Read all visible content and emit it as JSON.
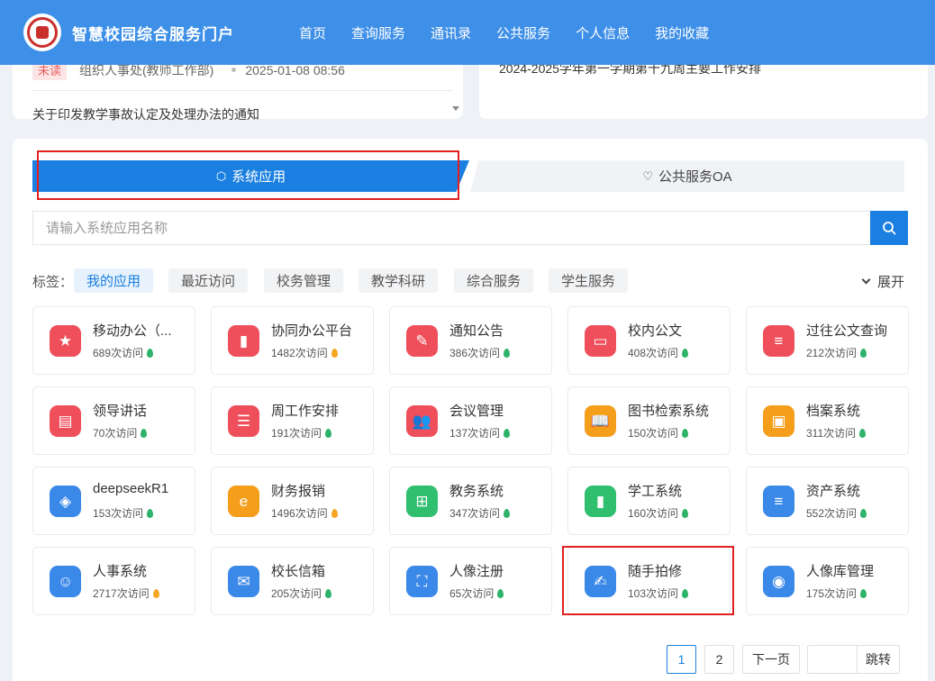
{
  "header": {
    "title": "智慧校园综合服务门户",
    "nav": [
      "首页",
      "查询服务",
      "通讯录",
      "公共服务",
      "个人信息",
      "我的收藏"
    ]
  },
  "notices": {
    "badge": "未读",
    "source": "组织人事处(教师工作部)",
    "date": "2025-01-08 08:56",
    "item2": "关于印发教学事故认定及处理办法的通知",
    "right_item": "2024-2025学年第一学期第十九周主要工作安排"
  },
  "tabs": {
    "system": "系统应用",
    "oa": "公共服务OA"
  },
  "search": {
    "placeholder": "请输入系统应用名称"
  },
  "tags": {
    "label": "标签：",
    "items": [
      "我的应用",
      "最近访问",
      "校务管理",
      "教学科研",
      "综合服务",
      "学生服务"
    ],
    "expand": "展开"
  },
  "apps": [
    {
      "name": "移动办公（...",
      "visits": "689次访问",
      "flame": "green",
      "color": "#ee4f5b",
      "icon": "bookmark-icon"
    },
    {
      "name": "协同办公平台",
      "visits": "1482次访问",
      "flame": "orange",
      "color": "#ee4f5b",
      "icon": "bar-chart-icon"
    },
    {
      "name": "通知公告",
      "visits": "386次访问",
      "flame": "green",
      "color": "#ee4f5b",
      "icon": "edit-icon"
    },
    {
      "name": "校内公文",
      "visits": "408次访问",
      "flame": "green",
      "color": "#ee4f5b",
      "icon": "monitor-icon"
    },
    {
      "name": "过往公文查询",
      "visits": "212次访问",
      "flame": "green",
      "color": "#ee4f5b",
      "icon": "list-icon"
    },
    {
      "name": "领导讲话",
      "visits": "70次访问",
      "flame": "green",
      "color": "#ee4f5b",
      "icon": "document-icon"
    },
    {
      "name": "周工作安排",
      "visits": "191次访问",
      "flame": "green",
      "color": "#ee4f5b",
      "icon": "server-icon"
    },
    {
      "name": "会议管理",
      "visits": "137次访问",
      "flame": "green",
      "color": "#ee4f5b",
      "icon": "users-icon"
    },
    {
      "name": "图书检索系统",
      "visits": "150次访问",
      "flame": "green",
      "color": "#f59e1b",
      "icon": "book-icon"
    },
    {
      "name": "档案系统",
      "visits": "311次访问",
      "flame": "green",
      "color": "#f59e1b",
      "icon": "id-card-icon"
    },
    {
      "name": "deepseekR1",
      "visits": "153次访问",
      "flame": "green",
      "color": "#3a88e8",
      "icon": "layers-search-icon"
    },
    {
      "name": "财务报销",
      "visits": "1496次访问",
      "flame": "orange",
      "color": "#f59e1b",
      "icon": "ie-logo-icon"
    },
    {
      "name": "教务系统",
      "visits": "347次访问",
      "flame": "green",
      "color": "#2fbf6e",
      "icon": "grid-icon"
    },
    {
      "name": "学工系统",
      "visits": "160次访问",
      "flame": "green",
      "color": "#2fbf6e",
      "icon": "bar-chart-icon"
    },
    {
      "name": "资产系统",
      "visits": "552次访问",
      "flame": "green",
      "color": "#3a88e8",
      "icon": "list-icon"
    },
    {
      "name": "人事系统",
      "visits": "2717次访问",
      "flame": "orange",
      "color": "#3a88e8",
      "icon": "user-card-icon"
    },
    {
      "name": "校长信箱",
      "visits": "205次访问",
      "flame": "green",
      "color": "#3a88e8",
      "icon": "mail-icon"
    },
    {
      "name": "人像注册",
      "visits": "65次访问",
      "flame": "green",
      "color": "#3a88e8",
      "icon": "scan-icon"
    },
    {
      "name": "随手拍修",
      "visits": "103次访问",
      "flame": "green",
      "color": "#3a88e8",
      "icon": "note-edit-icon"
    },
    {
      "name": "人像库管理",
      "visits": "175次访问",
      "flame": "green",
      "color": "#3a88e8",
      "icon": "fingerprint-icon"
    }
  ],
  "pagination": {
    "pages": [
      "1",
      "2"
    ],
    "next": "下一页",
    "jump": "跳转",
    "current": "1"
  }
}
